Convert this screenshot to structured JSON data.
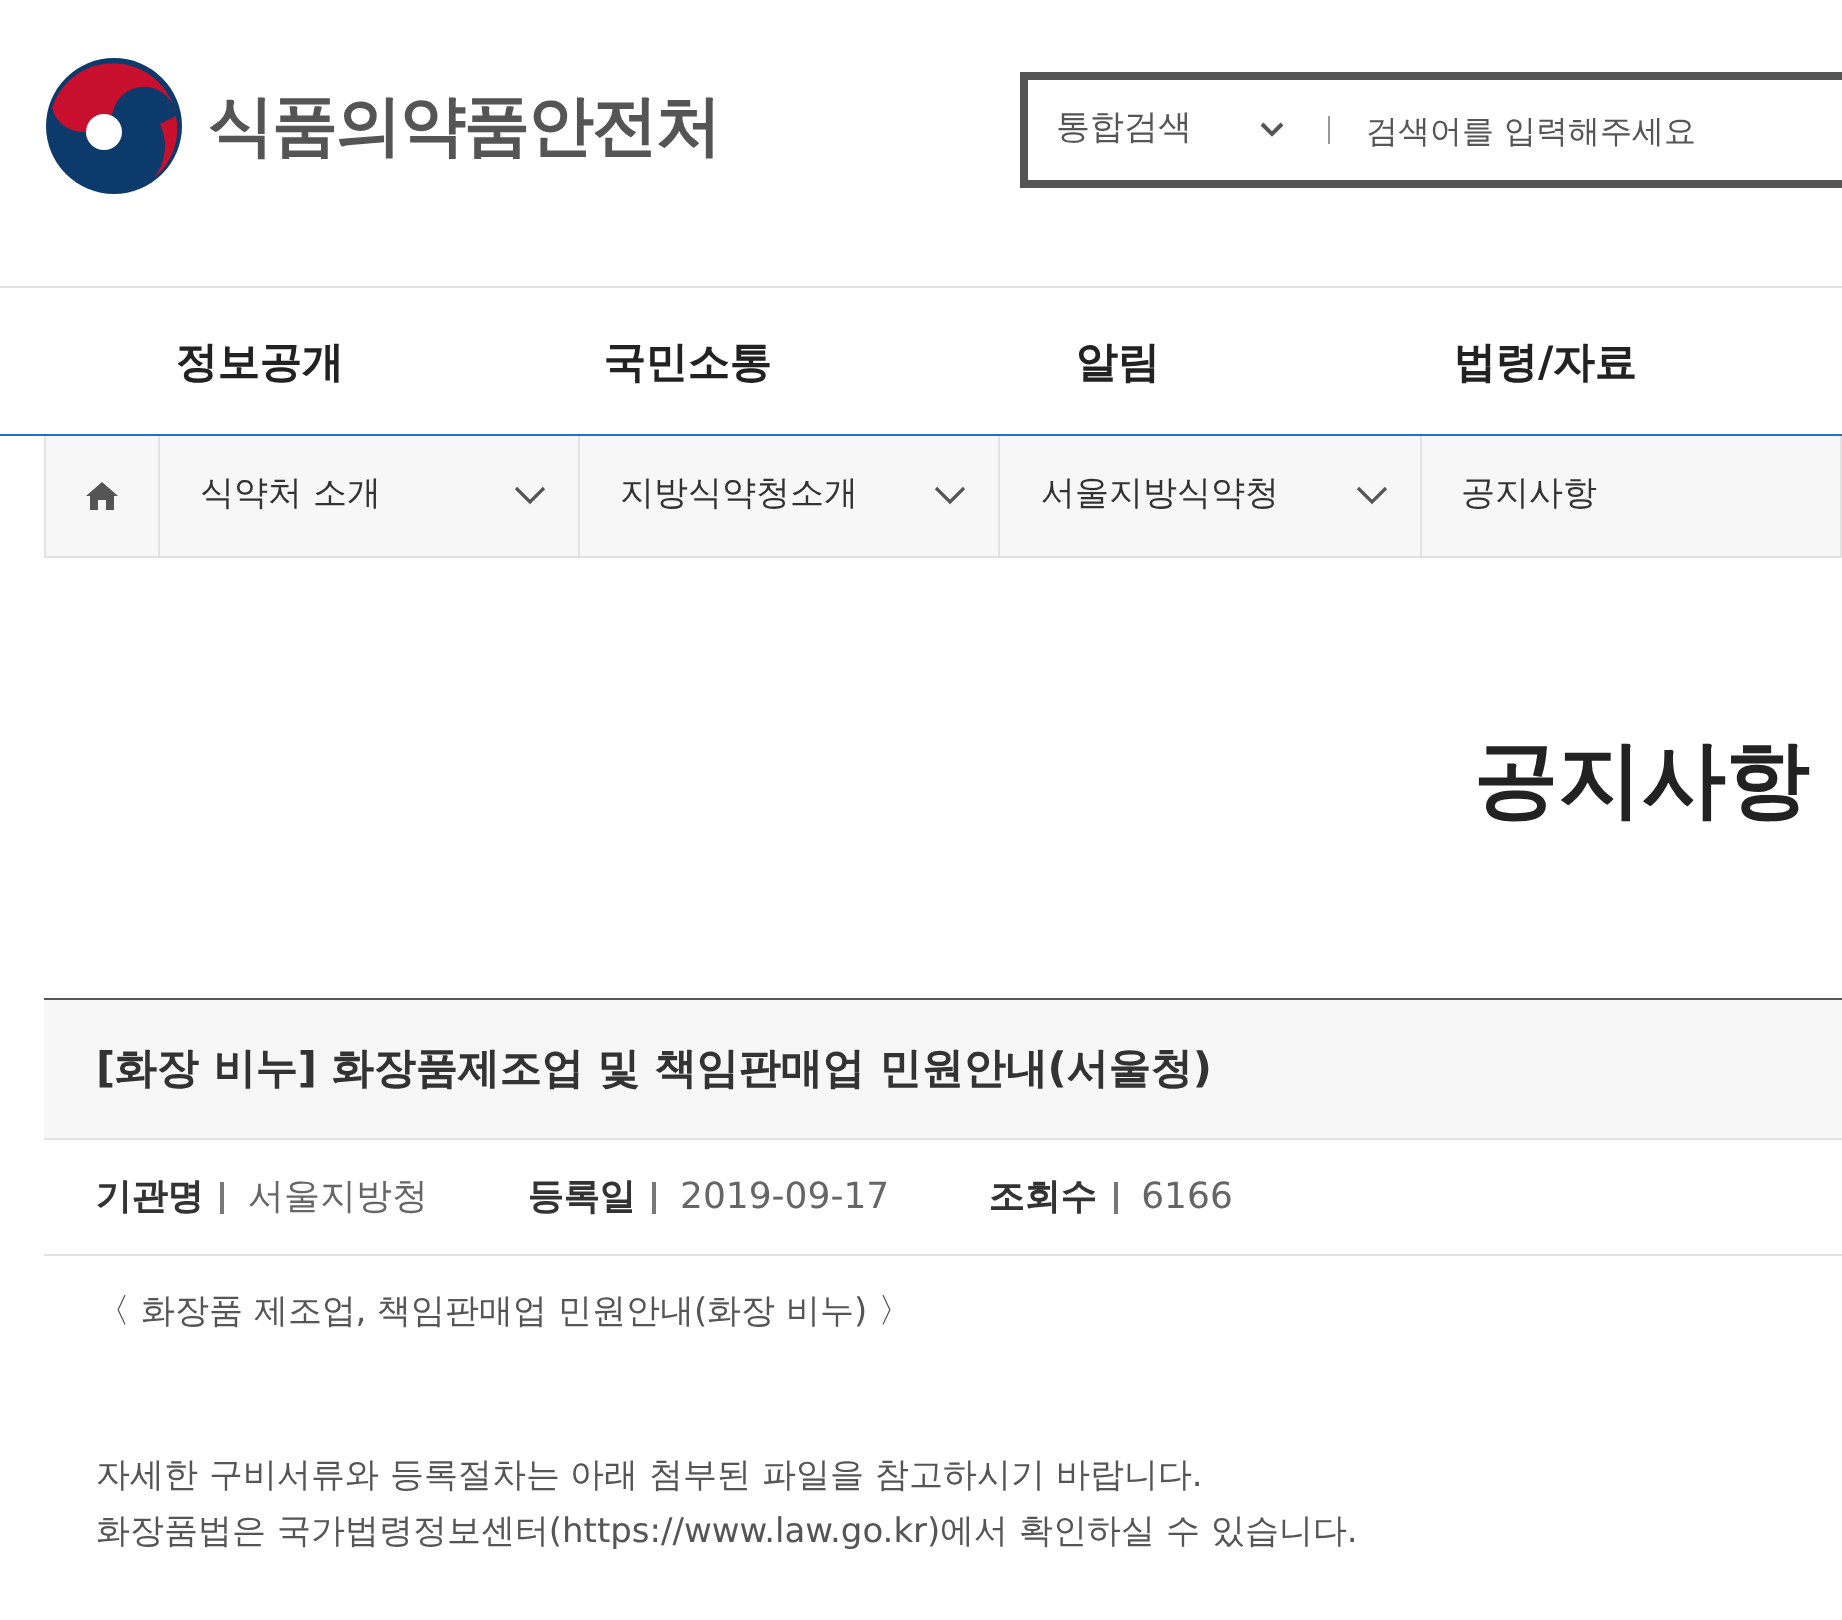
{
  "header": {
    "logo_text": "식품의약품안전처",
    "search": {
      "scope": "통합검색",
      "placeholder": "검색어를 입력해주세요"
    }
  },
  "main_nav": [
    {
      "label": "정보공개"
    },
    {
      "label": "국민소통"
    },
    {
      "label": "알림"
    },
    {
      "label": "법령/자료"
    }
  ],
  "breadcrumb": [
    {
      "label": "식약처 소개",
      "dropdown": true
    },
    {
      "label": "지방식약청소개",
      "dropdown": true
    },
    {
      "label": "서울지방식약청",
      "dropdown": true
    },
    {
      "label": "공지사항",
      "dropdown": false
    }
  ],
  "page_title": "공지사항",
  "post": {
    "title": "[화장 비누] 화장품제조업 및 책임판매업 민원안내(서울청)",
    "meta": [
      {
        "label": "기관명",
        "value": "서울지방청"
      },
      {
        "label": "등록일",
        "value": "2019-09-17"
      },
      {
        "label": "조회수",
        "value": "6166"
      }
    ],
    "body": [
      "〈 화장품 제조업, 책임판매업 민원안내(화장 비누) 〉",
      "자세한 구비서류와 등록절차는 아래 첨부된 파일을 참고하시기 바랍니다.",
      "화장품법은 국가법령정보센터(https://www.law.go.kr)에서 확인하실 수 있습니다."
    ]
  }
}
